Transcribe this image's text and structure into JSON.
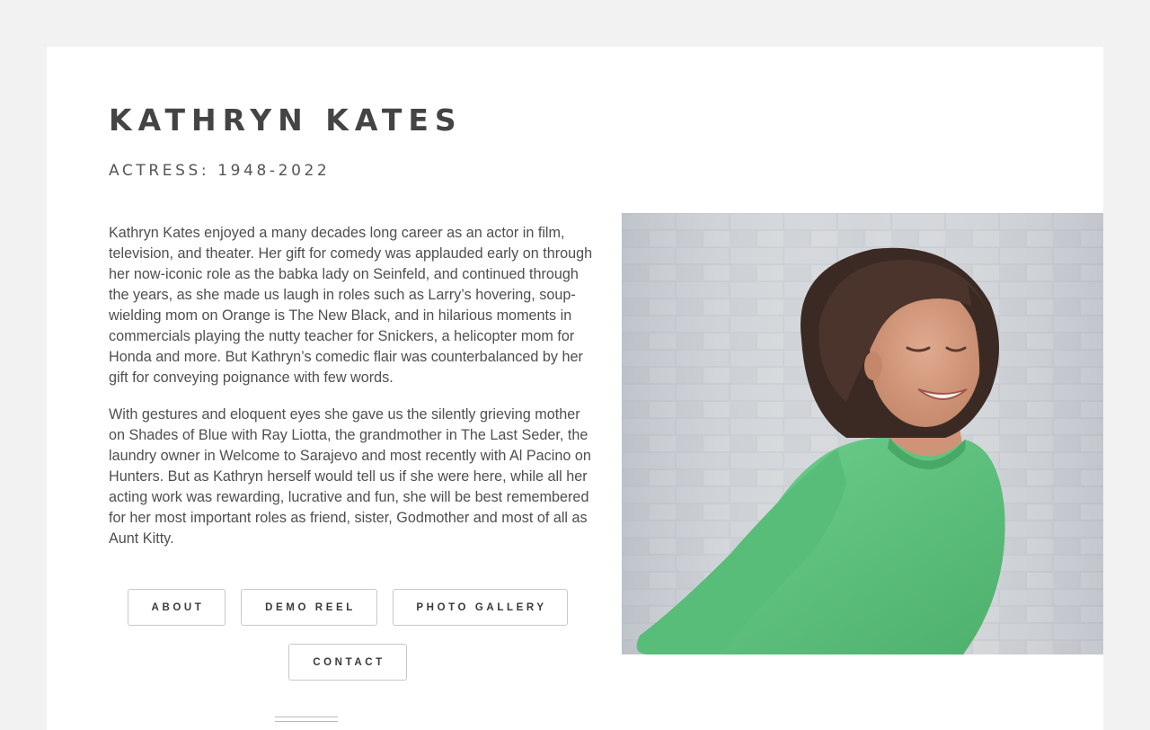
{
  "header": {
    "name": "KATHRYN KATES",
    "subtitle": "ACTRESS: 1948-2022"
  },
  "bio": {
    "paragraphs": [
      "Kathryn Kates enjoyed a many decades long career as an actor in film, television, and theater. Her gift for comedy was applauded early on through her now-iconic role as the babka lady on Seinfeld, and continued through the years, as she made us laugh in roles such as Larry’s hovering, soup-wielding mom on Orange is The New Black, and in hilarious moments in commercials playing the nutty teacher for Snickers, a helicopter mom for Honda and more. But Kathryn’s comedic flair was counterbalanced by her gift for conveying poignance with few words.",
      "With gestures and eloquent eyes she gave us the silently grieving mother on Shades of Blue with Ray Liotta, the grandmother in The Last Seder, the laundry owner in Welcome to Sarajevo and most recently with Al Pacino on Hunters. But as Kathryn herself would tell us if she were here, while all her acting work was rewarding, lucrative and fun, she will be best remembered for her most important roles as friend, sister, Godmother and most of all as Aunt Kitty."
    ]
  },
  "nav": {
    "about": "ABOUT",
    "demo_reel": "DEMO REEL",
    "photo_gallery": "PHOTO GALLERY",
    "contact": "CONTACT"
  },
  "colors": {
    "page_background": "#f2f2f2",
    "card_background": "#ffffff",
    "heading_text": "#444444",
    "body_text": "#4f4f4f",
    "button_border": "#c8c8c8",
    "shirt_green": "#5fc57f",
    "brick_wall": "#c9ccd0"
  },
  "photo": {
    "subject": "portrait-photo"
  }
}
